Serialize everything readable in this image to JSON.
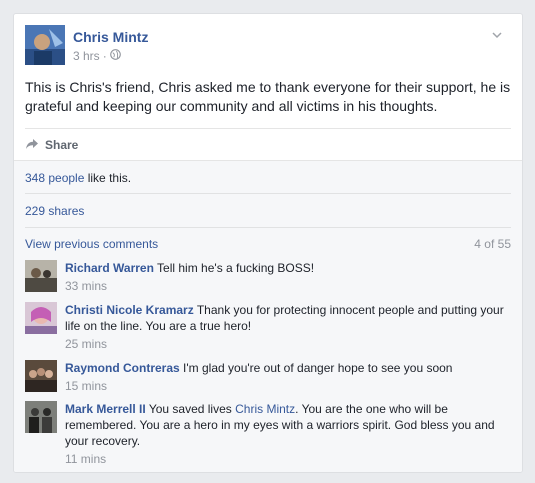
{
  "post": {
    "author": "Chris Mintz",
    "time": "3 hrs",
    "separator": "·",
    "text": "This is Chris's friend, Chris asked me to thank everyone for their support, he is grateful and keeping our community and all victims in his thoughts.",
    "share_label": "Share"
  },
  "stats": {
    "likes_link": "348 people",
    "likes_suffix": " like this.",
    "shares": "229 shares"
  },
  "comments_header": {
    "view_previous": "View previous comments",
    "count": "4 of 55"
  },
  "comments": [
    {
      "name": "Richard Warren",
      "text": "Tell him he's a fucking BOSS!",
      "time": "33 mins"
    },
    {
      "name": "Christi Nicole Kramarz",
      "text": "Thank you for protecting innocent people and putting your life on the line. You are a true hero!",
      "time": "25 mins"
    },
    {
      "name": "Raymond Contreras",
      "text": "I'm glad you're out of danger hope to see you soon",
      "time": "15 mins"
    },
    {
      "name": "Mark Merrell II",
      "text_before": "You saved lives ",
      "mention": "Chris Mintz",
      "text_after": ". You are the one who will be remembered. You are a hero in my eyes with a warriors spirit. God bless you and your recovery.",
      "time": "11 mins"
    }
  ],
  "colors": {
    "link": "#365899",
    "meta": "#90949c",
    "background": "#e9ebee"
  }
}
